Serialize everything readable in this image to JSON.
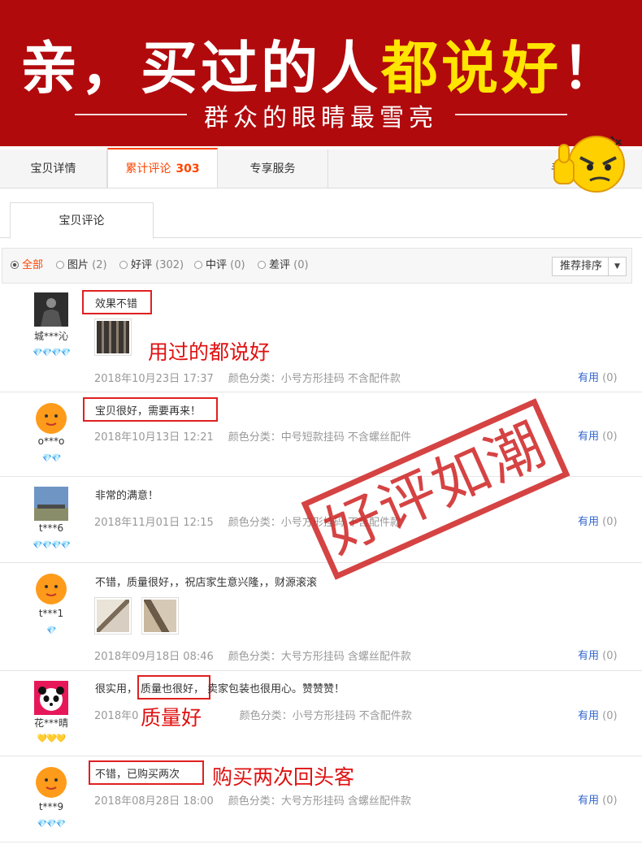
{
  "banner": {
    "title_part1": "亲，买过的人",
    "title_part2": "都说好",
    "title_part3": "！",
    "subtitle": "群众的眼睛最雪亮",
    "bg_color": "#b10a0d",
    "highlight_color": "#ffe500"
  },
  "tabs": {
    "details": "宝贝详情",
    "reviews_label": "累计评论",
    "reviews_count": "303",
    "service": "专享服务",
    "more": "手"
  },
  "subtab": "宝贝评论",
  "filters": {
    "all": "全部",
    "images": "图片",
    "images_count": "(2)",
    "good": "好评",
    "good_count": "(302)",
    "medium": "中评",
    "medium_count": "(0)",
    "bad": "差评",
    "bad_count": "(0)",
    "sort": "推荐排序"
  },
  "reviews": [
    {
      "user": "城***沁",
      "rank": "💎💎💎💎",
      "text": "效果不错",
      "date": "2018年10月23日 17:37",
      "color": "颜色分类：小号方形挂码 不含配件款",
      "useful": "有用",
      "useful_count": "(0)"
    },
    {
      "user": "o***o",
      "rank": "💎💎",
      "text": "宝贝很好，需要再来！",
      "date": "2018年10月13日 12:21",
      "color": "颜色分类：中号短款挂码 不含螺丝配件",
      "useful": "有用",
      "useful_count": "(0)"
    },
    {
      "user": "t***6",
      "rank": "💎💎💎💎",
      "text": "非常的满意！",
      "date": "2018年11月01日 12:15",
      "color": "颜色分类：小号方形挂码 不含配件款",
      "useful": "有用",
      "useful_count": "(0)"
    },
    {
      "user": "t***1",
      "rank": "💎",
      "text": "不错，质量很好，，祝店家生意兴隆，，财源滚滚",
      "date": "2018年09月18日 08:46",
      "color": "颜色分类：大号方形挂码 含螺丝配件款",
      "useful": "有用",
      "useful_count": "(0)"
    },
    {
      "user": "花***晴",
      "rank": "💛💛💛",
      "text_a": "很实用，",
      "text_b": "质量也很好，",
      "text_c": "卖家包装也很用心。赞赞赞！",
      "date": "2018年09",
      "color": "颜色分类：小号方形挂码 不含配件款",
      "useful": "有用",
      "useful_count": "(0)"
    },
    {
      "user": "t***9",
      "rank": "💎💎💎",
      "text": "不错，已购买两次",
      "date": "2018年08月28日 18:00",
      "color": "颜色分类：大号方形挂码 含螺丝配件款",
      "useful": "有用",
      "useful_count": "(0)"
    }
  ],
  "annotations": {
    "a1": "用过的都说好",
    "a2": "质量好",
    "a3": "购买两次回头客"
  },
  "stamp": "好评如潮"
}
